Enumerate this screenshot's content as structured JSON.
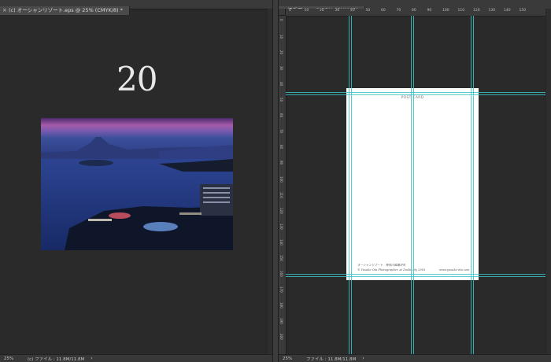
{
  "left_window": {
    "tab_close": "×",
    "tab_title": "(c) オーシャンリゾート.eps @ 25% (CMYK/8) *",
    "page_number": "20",
    "status": {
      "zoom": "25%",
      "file_info": "(c) ファイル : 11.8M/11.8M",
      "arrow": "›"
    }
  },
  "right_window": {
    "tab_close": "×",
    "tab_title": "切手面.eps @ 25% (CMYK/8)",
    "ruler_top_labels": [
      "0",
      "10",
      "20",
      "30",
      "40",
      "50",
      "60",
      "70",
      "80",
      "90",
      "100",
      "110",
      "120",
      "130",
      "140",
      "150"
    ],
    "ruler_left_labels": [
      "0",
      "10",
      "20",
      "30",
      "40",
      "50",
      "60",
      "70",
      "80",
      "90",
      "100",
      "110",
      "120",
      "130",
      "140",
      "150",
      "160",
      "170",
      "180",
      "190",
      "200"
    ],
    "postcard": {
      "title": "POST CARD",
      "caption": "オーシャンリゾート　神奈川県藤沢市",
      "credit": "© Yusuke Ota Photographer, at Zushi city 2016",
      "website": "www.yusuke-ota.com"
    },
    "status": {
      "zoom": "25%",
      "file_info": "ファイル : 11.8M/11.8M",
      "arrow": "›"
    }
  },
  "colors": {
    "canvas": "#2a2a2a",
    "chrome": "#3c3c3c",
    "guide": "#37c3c8"
  }
}
